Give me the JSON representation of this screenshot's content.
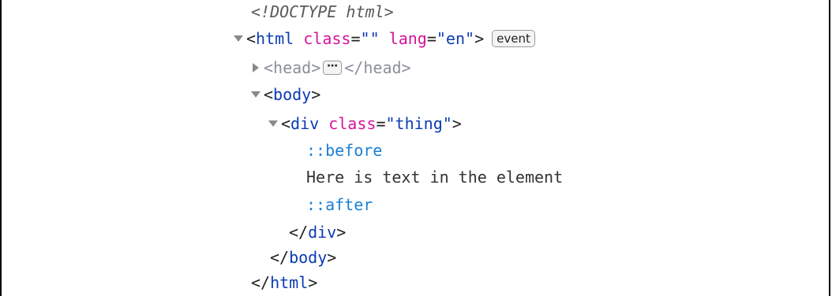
{
  "doctype": "<!DOCTYPE html>",
  "html_open": {
    "open_bracket": "<",
    "tag": "html",
    "attr1_name": "class",
    "attr1_eq": "=",
    "attr1_value": "\"\"",
    "attr2_name": "lang",
    "attr2_eq": "=",
    "attr2_value": "\"en\"",
    "close_bracket": ">",
    "badge": "event"
  },
  "head": {
    "open": "<",
    "tag": "head",
    "close": ">",
    "ellipsis": "⋯",
    "end_open": "</",
    "end_tag": "head",
    "end_close": ">"
  },
  "body_open": {
    "open": "<",
    "tag": "body",
    "close": ">"
  },
  "div_open": {
    "open": "<",
    "tag": "div",
    "attr_name": "class",
    "attr_eq": "=",
    "attr_value": "\"thing\"",
    "close": ">"
  },
  "before": "::before",
  "text_node": "Here is text in the element",
  "after": "::after",
  "div_close": {
    "open": "</",
    "tag": "div",
    "close": ">"
  },
  "body_close": {
    "open": "</",
    "tag": "body",
    "close": ">"
  },
  "html_close": {
    "open": "</",
    "tag": "html",
    "close": ">"
  }
}
